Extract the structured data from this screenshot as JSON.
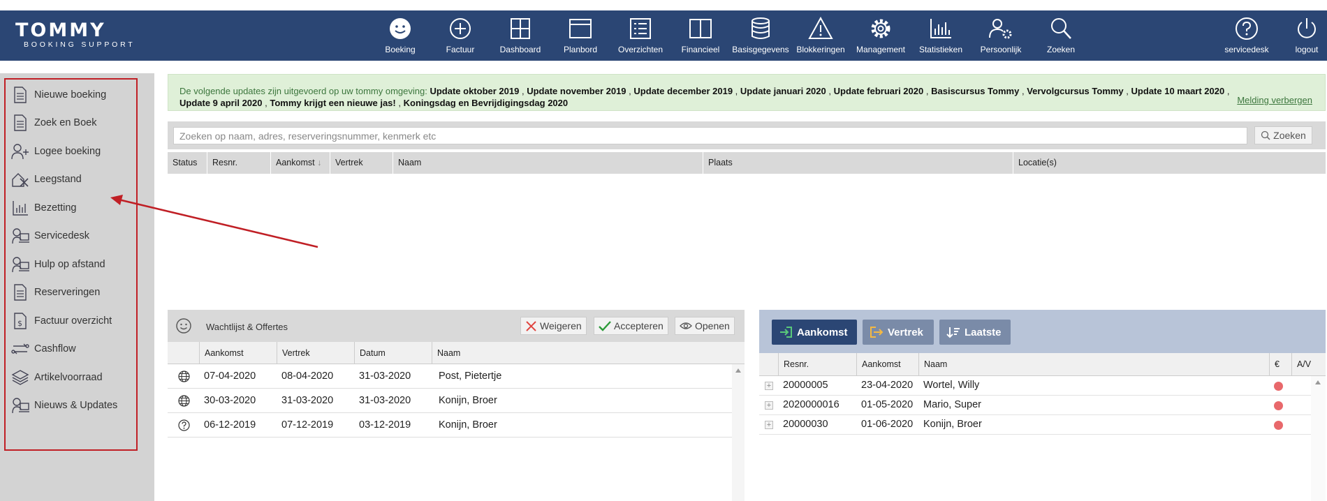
{
  "logo": {
    "line1": "TOMMY",
    "line2": "BOOKING SUPPORT"
  },
  "nav": {
    "items": [
      "Boeking",
      "Factuur",
      "Dashboard",
      "Planbord",
      "Overzichten",
      "Financieel",
      "Basisgegevens",
      "Blokkeringen",
      "Management",
      "Statistieken",
      "Persoonlijk",
      "Zoeken"
    ],
    "right": [
      "servicedesk",
      "logout"
    ]
  },
  "sidebar": {
    "items": [
      "Nieuwe boeking",
      "Zoek en Boek",
      "Logee boeking",
      "Leegstand",
      "Bezetting",
      "Servicedesk",
      "Hulp op afstand",
      "Reserveringen",
      "Factuur overzicht",
      "Cashflow",
      "Artikelvoorraad",
      "Nieuws & Updates"
    ]
  },
  "notice": {
    "intro": "De volgende updates zijn uitgevoerd op uw tommy omgeving:",
    "updates": [
      "Update oktober 2019",
      "Update november 2019",
      "Update december 2019",
      "Update januari 2020",
      "Update februari 2020",
      "Basiscursus Tommy",
      "Vervolgcursus Tommy",
      "Update 10 maart 2020",
      "Update 9 april 2020",
      "Tommy krijgt een nieuwe jas!",
      "Koningsdag en Bevrijdigingsdag 2020"
    ],
    "separator": ",",
    "hide_link": "Melding verbergen"
  },
  "search": {
    "placeholder": "Zoeken op naam, adres, reserveringsnummer, kenmerk etc",
    "button": "Zoeken"
  },
  "results_table": {
    "columns": [
      "Status",
      "Resnr.",
      "Aankomst",
      "Vertrek",
      "Naam",
      "Plaats",
      "Locatie(s)"
    ]
  },
  "waitlist": {
    "title": "Wachtlijst & Offertes",
    "buttons": {
      "reject": "Weigeren",
      "accept": "Accepteren",
      "open": "Openen"
    },
    "columns": [
      "Aankomst",
      "Vertrek",
      "Datum",
      "Naam"
    ],
    "rows": [
      {
        "icon": "globe-icon",
        "aankomst": "07-04-2020",
        "vertrek": "08-04-2020",
        "datum": "31-03-2020",
        "naam": "Post, Pietertje"
      },
      {
        "icon": "globe-icon",
        "aankomst": "30-03-2020",
        "vertrek": "31-03-2020",
        "datum": "31-03-2020",
        "naam": "Konijn, Broer"
      },
      {
        "icon": "question-icon",
        "aankomst": "06-12-2019",
        "vertrek": "07-12-2019",
        "datum": "03-12-2019",
        "naam": "Konijn, Broer"
      }
    ]
  },
  "arrivals": {
    "tabs": [
      "Aankomst",
      "Vertrek",
      "Laatste"
    ],
    "tab_colors": [
      "#2b4674",
      "#7a8ba8",
      "#7a8ba8"
    ],
    "tab_icon_colors": [
      "#59c97a",
      "#f5b942",
      "#ffffff"
    ],
    "columns": [
      "Resnr.",
      "Aankomst",
      "Naam",
      "€",
      "A/V"
    ],
    "rows": [
      {
        "resnr": "20000005",
        "aankomst": "23-04-2020",
        "naam": "Wortel, Willy"
      },
      {
        "resnr": "2020000016",
        "aankomst": "01-05-2020",
        "naam": "Mario, Super"
      },
      {
        "resnr": "20000030",
        "aankomst": "01-06-2020",
        "naam": "Konijn, Broer"
      }
    ]
  },
  "colors": {
    "header": "#2b4674",
    "annotation": "#c01f25",
    "notice_bg": "#dff0d8",
    "status_dot": "#e8686b"
  }
}
